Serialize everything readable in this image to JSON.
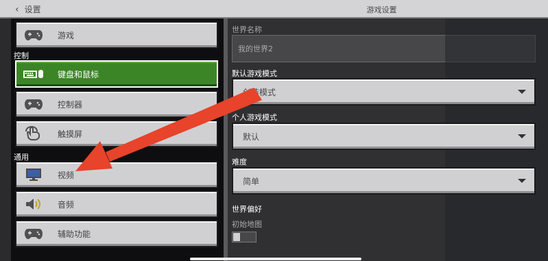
{
  "header": {
    "back_label": "设置",
    "title": "游戏设置"
  },
  "sidebar": {
    "top_item": {
      "label": "游戏",
      "icon": "controller-icon"
    },
    "sections": [
      {
        "label": "控制",
        "items": [
          {
            "label": "键盘和鼠标",
            "icon": "keyboard-mouse-icon",
            "active": true
          },
          {
            "label": "控制器",
            "icon": "controller-icon",
            "active": false
          },
          {
            "label": "触摸屏",
            "icon": "touch-icon",
            "active": false
          }
        ]
      },
      {
        "label": "通用",
        "items": [
          {
            "label": "视频",
            "icon": "monitor-icon",
            "active": false
          },
          {
            "label": "音频",
            "icon": "speaker-icon",
            "active": false
          },
          {
            "label": "辅助功能",
            "icon": "controller-icon",
            "active": false
          }
        ]
      }
    ]
  },
  "main": {
    "world_name": {
      "label": "世界名称",
      "value": "我的世界2"
    },
    "default_mode": {
      "label": "默认游戏模式",
      "value": "创造模式"
    },
    "personal_mode": {
      "label": "个人游戏模式",
      "value": "默认"
    },
    "difficulty": {
      "label": "难度",
      "value": "简单"
    },
    "world_prefs": {
      "label": "世界偏好",
      "starting_map_label": "初始地图"
    }
  },
  "colors": {
    "active_green": "#3c8527",
    "arrow_red": "#e8432b"
  }
}
